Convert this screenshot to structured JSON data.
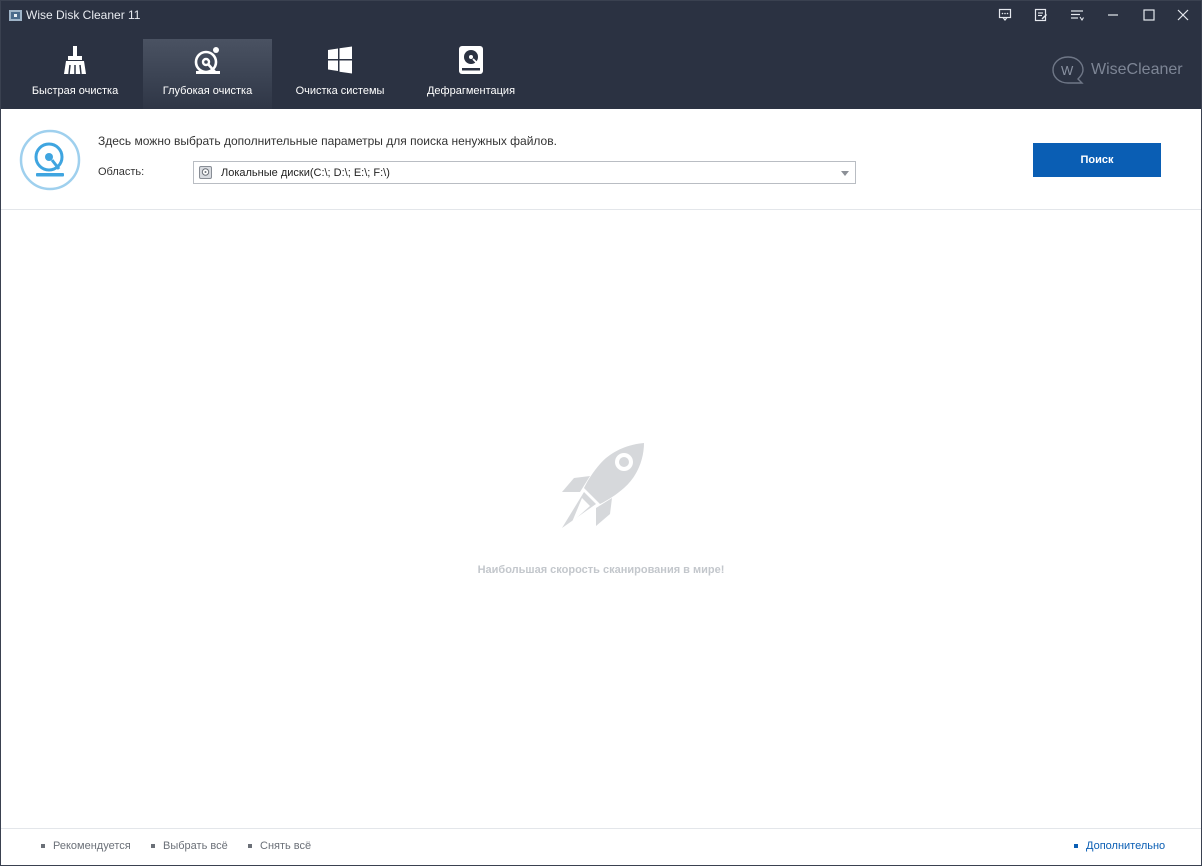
{
  "window": {
    "title": "Wise Disk Cleaner 11",
    "controls": [
      "feedback-icon",
      "notes-icon",
      "menu-icon",
      "minimize-icon",
      "maximize-icon",
      "close-icon"
    ]
  },
  "toolbar": {
    "tabs": [
      {
        "label": "Быстрая очистка",
        "icon": "broom-icon",
        "active": false
      },
      {
        "label": "Глубокая очистка",
        "icon": "deep-clean-icon",
        "active": true
      },
      {
        "label": "Очистка системы",
        "icon": "windows-icon",
        "active": false
      },
      {
        "label": "Дефрагментация",
        "icon": "hard-drive-icon",
        "active": false
      }
    ],
    "brand": "WiseCleaner",
    "brand_letter": "W"
  },
  "options": {
    "description": "Здесь можно выбрать дополнительные параметры для поиска ненужных файлов.",
    "area_label": "Область:",
    "area_value": "Локальные диски(C:\\; D:\\; E:\\; F:\\)",
    "scan_button": "Поиск"
  },
  "main": {
    "slogan": "Наибольшая скорость сканирования в мире!"
  },
  "footer": {
    "recommended": "Рекомендуется",
    "select_all": "Выбрать всё",
    "deselect_all": "Снять всё",
    "more": "Дополнительно"
  },
  "colors": {
    "titlebar": "#2b3242",
    "accent": "#0a5eb4",
    "slogan": "#c3c7cc"
  }
}
